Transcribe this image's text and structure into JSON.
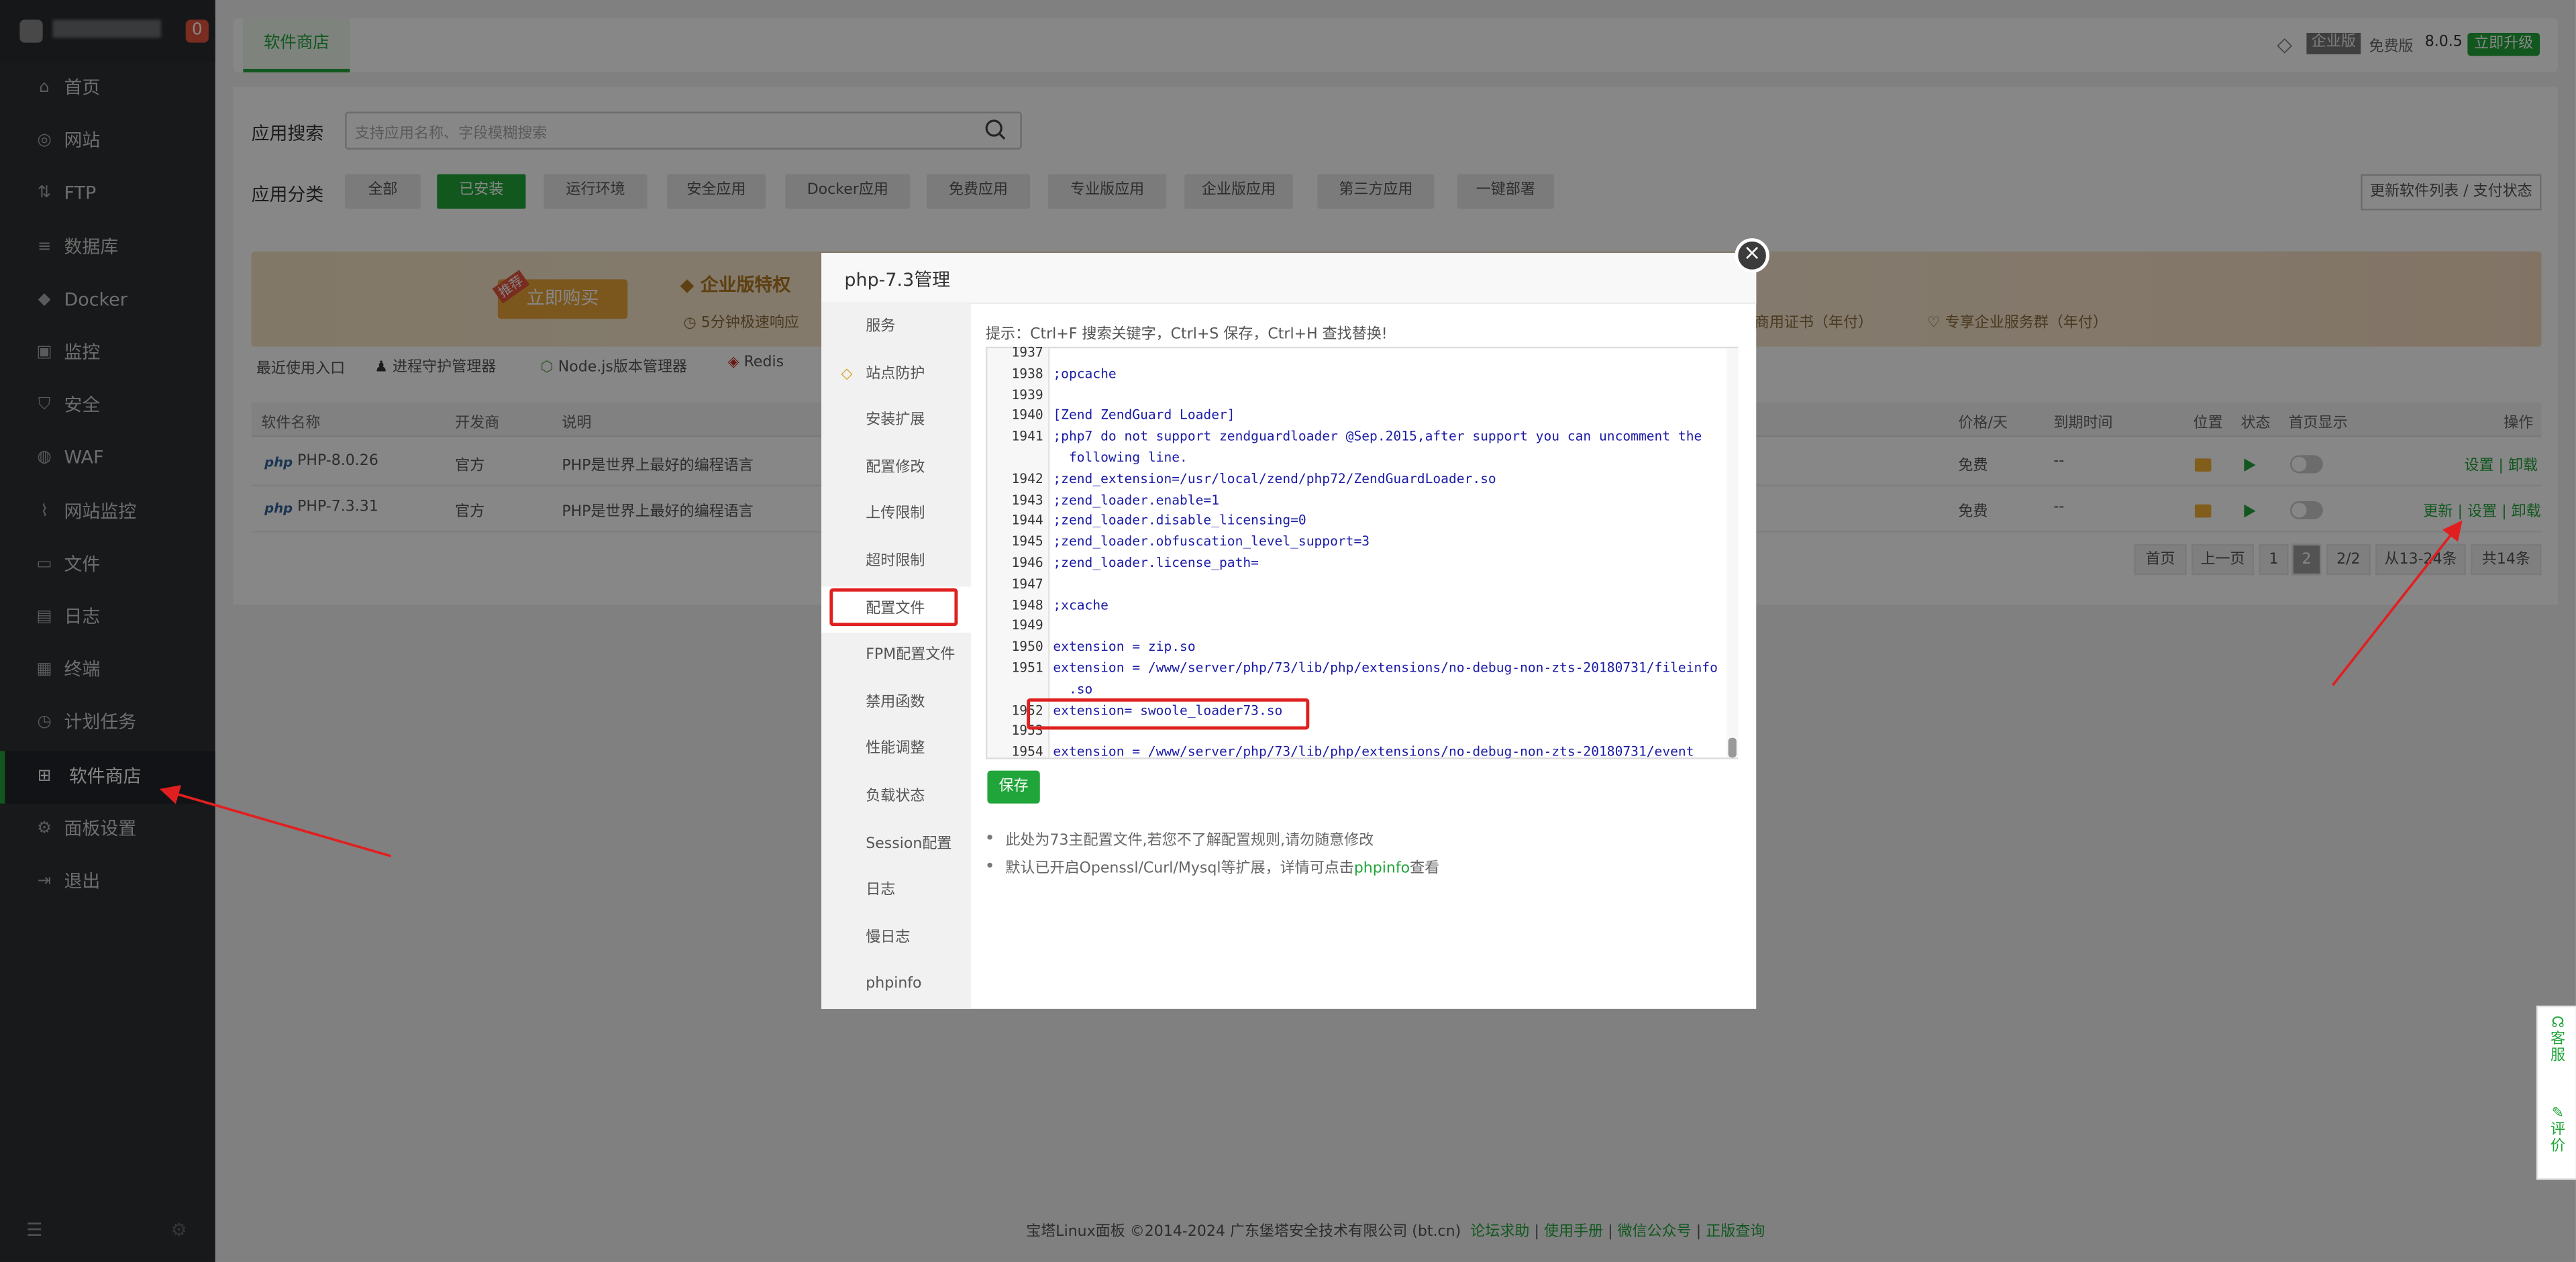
{
  "sidebar": {
    "badge": "0",
    "items": [
      {
        "label": "首页",
        "icon": "home-icon",
        "glyph": "⌂"
      },
      {
        "label": "网站",
        "icon": "globe-icon",
        "glyph": "◎"
      },
      {
        "label": "FTP",
        "icon": "ftp-icon",
        "glyph": "⇅"
      },
      {
        "label": "数据库",
        "icon": "database-icon",
        "glyph": "≡"
      },
      {
        "label": "Docker",
        "icon": "docker-icon",
        "glyph": "◆"
      },
      {
        "label": "监控",
        "icon": "monitor-icon",
        "glyph": "▣"
      },
      {
        "label": "安全",
        "icon": "shield-icon",
        "glyph": "⛉"
      },
      {
        "label": "WAF",
        "icon": "waf-icon",
        "glyph": "◍"
      },
      {
        "label": "网站监控",
        "icon": "chart-icon",
        "glyph": "⌇"
      },
      {
        "label": "文件",
        "icon": "folder-icon",
        "glyph": "▭"
      },
      {
        "label": "日志",
        "icon": "log-icon",
        "glyph": "▤"
      },
      {
        "label": "终端",
        "icon": "terminal-icon",
        "glyph": "▦"
      },
      {
        "label": "计划任务",
        "icon": "clock-icon",
        "glyph": "◷"
      },
      {
        "label": "软件商店",
        "icon": "apps-icon",
        "glyph": "⊞"
      },
      {
        "label": "面板设置",
        "icon": "gear-icon",
        "glyph": "⚙"
      },
      {
        "label": "退出",
        "icon": "logout-icon",
        "glyph": "⇥"
      }
    ],
    "active_index": 13
  },
  "header": {
    "tab": "软件商店",
    "edition": "企业版",
    "free": "免费版",
    "version": "8.0.5",
    "upgrade": "立即升级"
  },
  "search": {
    "label": "应用搜索",
    "placeholder": "支持应用名称、字段模糊搜索"
  },
  "categories": {
    "label": "应用分类",
    "items": [
      "全部",
      "已安装",
      "运行环境",
      "安全应用",
      "Docker应用",
      "免费应用",
      "专业版应用",
      "企业版应用",
      "第三方应用",
      "一键部署"
    ],
    "selected": "已安装",
    "refresh": "更新软件列表 / 支付状态"
  },
  "banner": {
    "tag": "推荐",
    "buy": "立即购买",
    "title": "企业版特权",
    "sub": "5分钟极速响应",
    "cert": "商用证书（年付）",
    "service": "专享企业服务群（年付）"
  },
  "recent": {
    "label": "最近使用入口",
    "items": [
      "进程守护管理器",
      "Node.js版本管理器",
      "Redis"
    ]
  },
  "table": {
    "headers": [
      "软件名称",
      "开发商",
      "说明",
      "价格/天",
      "到期时间",
      "位置",
      "状态",
      "首页显示",
      "操作"
    ],
    "rows": [
      {
        "name": "PHP-8.0.26",
        "vendor": "官方",
        "desc": "PHP是世界上最好的编程语言",
        "price": "免费",
        "expire": "--",
        "ops": "设置 | 卸载"
      },
      {
        "name": "PHP-7.3.31",
        "vendor": "官方",
        "desc": "PHP是世界上最好的编程语言",
        "price": "免费",
        "expire": "--",
        "ops_update": "更新",
        "ops": "设置 | 卸载"
      }
    ],
    "php_badge": "php"
  },
  "pagination": {
    "first": "首页",
    "prev": "上一页",
    "p1": "1",
    "p2": "2",
    "pages": "2/2",
    "range": "从13-24条",
    "total": "共14条"
  },
  "modal": {
    "title": "php-7.3管理",
    "close": "×",
    "menu": [
      "服务",
      "站点防护",
      "安装扩展",
      "配置修改",
      "上传限制",
      "超时限制",
      "配置文件",
      "FPM配置文件",
      "禁用函数",
      "性能调整",
      "负载状态",
      "Session配置",
      "日志",
      "慢日志",
      "phpinfo"
    ],
    "active_menu": "配置文件",
    "hint": "提示：Ctrl+F 搜索关键字，Ctrl+S 保存，Ctrl+H 查找替换!",
    "save": "保存",
    "note1": "此处为73主配置文件,若您不了解配置规则,请勿随意修改",
    "note2_prefix": "默认已开启Openssl/Curl/Mysql等扩展，详情可点击",
    "note2_link": "phpinfo",
    "note2_suffix": "查看",
    "code_lines": [
      {
        "n": "1937",
        "t": ""
      },
      {
        "n": "1938",
        "t": ";opcache"
      },
      {
        "n": "1939",
        "t": ""
      },
      {
        "n": "1940",
        "t": "[Zend ZendGuard Loader]"
      },
      {
        "n": "1941",
        "t": ";php7 do not support zendguardloader @Sep.2015,after support you can uncomment the"
      },
      {
        "n": "",
        "t": "  following line."
      },
      {
        "n": "1942",
        "t": ";zend_extension=/usr/local/zend/php72/ZendGuardLoader.so"
      },
      {
        "n": "1943",
        "t": ";zend_loader.enable=1"
      },
      {
        "n": "1944",
        "t": ";zend_loader.disable_licensing=0"
      },
      {
        "n": "1945",
        "t": ";zend_loader.obfuscation_level_support=3"
      },
      {
        "n": "1946",
        "t": ";zend_loader.license_path="
      },
      {
        "n": "1947",
        "t": ""
      },
      {
        "n": "1948",
        "t": ";xcache"
      },
      {
        "n": "1949",
        "t": ""
      },
      {
        "n": "1950",
        "t": "extension = zip.so"
      },
      {
        "n": "1951",
        "t": "extension = /www/server/php/73/lib/php/extensions/no-debug-non-zts-20180731/fileinfo"
      },
      {
        "n": "",
        "t": "  .so"
      },
      {
        "n": "1952",
        "t": "extension= swoole_loader73.so"
      },
      {
        "n": "1953",
        "t": ""
      },
      {
        "n": "1954",
        "t": "extension = /www/server/php/73/lib/php/extensions/no-debug-non-zts-20180731/event"
      }
    ]
  },
  "footer": {
    "copy": "宝塔Linux面板 ©2014-2024 广东堡塔安全技术有限公司 (bt.cn)",
    "links": [
      "论坛求助",
      "使用手册",
      "微信公众号",
      "正版查询"
    ]
  },
  "side_float": {
    "service": "客服",
    "review": "评价"
  }
}
